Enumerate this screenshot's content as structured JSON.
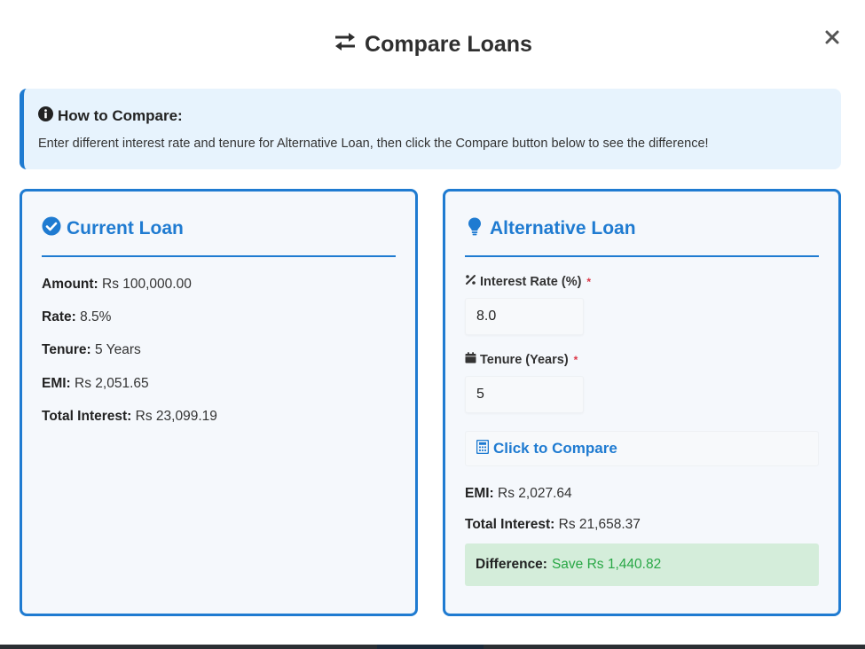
{
  "modal": {
    "title": "Compare Loans",
    "title_icon": "exchange-arrows-icon",
    "close_icon": "close-x-icon"
  },
  "info": {
    "title": "How to Compare:",
    "icon": "info-circle-icon",
    "text": "Enter different interest rate and tenure for Alternative Loan, then click the Compare button below to see the difference!"
  },
  "current_loan": {
    "title": "Current Loan",
    "icon": "check-circle-icon",
    "amount_label": "Amount:",
    "amount_value": "Rs 100,000.00",
    "rate_label": "Rate:",
    "rate_value": "8.5%",
    "tenure_label": "Tenure:",
    "tenure_value": "5 Years",
    "emi_label": "EMI:",
    "emi_value": "Rs 2,051.65",
    "interest_label": "Total Interest:",
    "interest_value": "Rs 23,099.19"
  },
  "alternative_loan": {
    "title": "Alternative Loan",
    "icon": "lightbulb-icon",
    "rate_label": "Interest Rate (%)",
    "rate_icon": "percent-icon",
    "rate_value": "8.0",
    "tenure_label": "Tenure (Years)",
    "tenure_icon": "calendar-icon",
    "tenure_value": "5",
    "required_mark": "*",
    "compare_label": "Click to Compare",
    "compare_icon": "calculator-icon",
    "emi_label": "EMI:",
    "emi_value": "Rs 2,027.64",
    "interest_label": "Total Interest:",
    "interest_value": "Rs 21,658.37",
    "difference_label": "Difference:",
    "difference_value": "Save Rs 1,440.82"
  },
  "colors": {
    "accent": "#1f7bd1",
    "info_bg": "#e7f3fd",
    "card_bg": "#f5f8fc",
    "success_bg": "#d4edda",
    "success_text": "#28a745",
    "required": "#dc3545"
  }
}
